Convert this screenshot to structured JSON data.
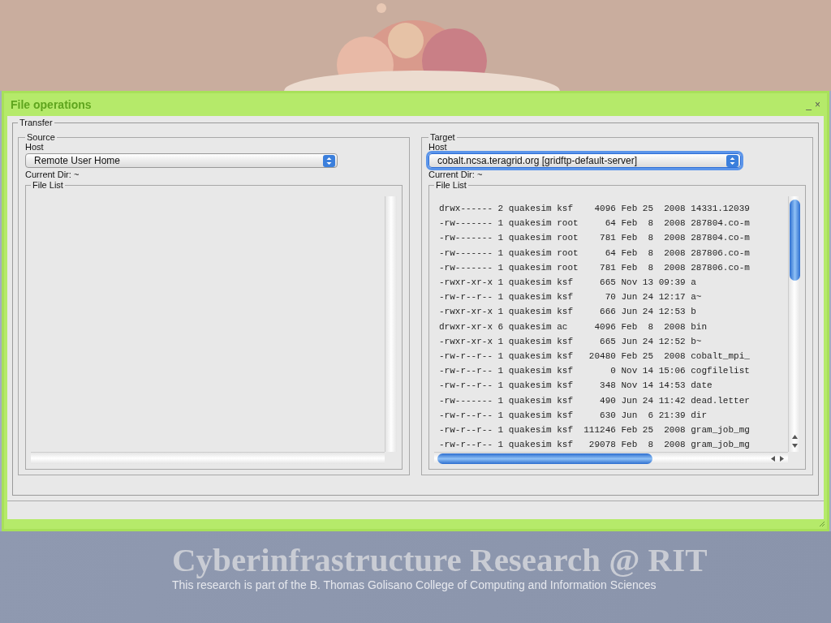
{
  "slide": {
    "title": "Cyberinfrastructure Research @ RIT",
    "subtitle": "This research is part of the B. Thomas Golisano College of Computing and Information Sciences"
  },
  "window": {
    "title": "File operations",
    "minimize": "_",
    "close": "×"
  },
  "transfer": {
    "legend": "Transfer",
    "panels": [
      {
        "legend": "Source",
        "host_label": "Host",
        "host": "Remote User Home",
        "focused": false,
        "current_dir": "Current Dir: ~",
        "file_list_legend": "File List"
      },
      {
        "legend": "Target",
        "host_label": "Host",
        "host": "cobalt.ncsa.teragrid.org [gridftp-default-server]",
        "focused": true,
        "current_dir": "Current Dir: ~",
        "file_list_legend": "File List",
        "files": [
          "drwx------ 2 quakesim ksf    4096 Feb 25  2008 14331.12039",
          "-rw------- 1 quakesim root     64 Feb  8  2008 287804.co-m",
          "-rw------- 1 quakesim root    781 Feb  8  2008 287804.co-m",
          "-rw------- 1 quakesim root     64 Feb  8  2008 287806.co-m",
          "-rw------- 1 quakesim root    781 Feb  8  2008 287806.co-m",
          "-rwxr-xr-x 1 quakesim ksf     665 Nov 13 09:39 a",
          "-rw-r--r-- 1 quakesim ksf      70 Jun 24 12:17 a~",
          "-rwxr-xr-x 1 quakesim ksf     666 Jun 24 12:53 b",
          "drwxr-xr-x 6 quakesim ac     4096 Feb  8  2008 bin",
          "-rwxr-xr-x 1 quakesim ksf     665 Jun 24 12:52 b~",
          "-rw-r--r-- 1 quakesim ksf   20480 Feb 25  2008 cobalt_mpi_",
          "-rw-r--r-- 1 quakesim ksf       0 Nov 14 15:06 cogfilelist",
          "-rw-r--r-- 1 quakesim ksf     348 Nov 14 14:53 date",
          "-rw------- 1 quakesim ksf     490 Jun 24 11:42 dead.letter",
          "-rw-r--r-- 1 quakesim ksf     630 Jun  6 21:39 dir",
          "-rw-r--r-- 1 quakesim ksf  111246 Feb 25  2008 gram_job_mg",
          "-rw-r--r-- 1 quakesim ksf   29078 Feb  8  2008 gram_job_mg"
        ]
      }
    ]
  }
}
